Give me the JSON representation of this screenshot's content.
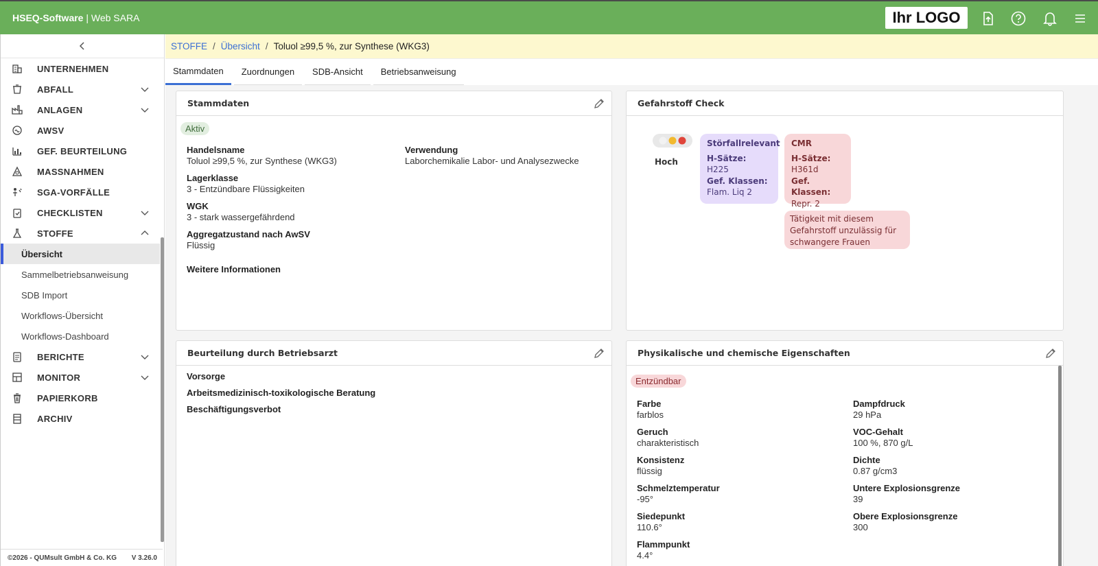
{
  "app": {
    "brand_bold": "HSEQ-Software",
    "brand_rest": " | Web SARA",
    "logo_text": "Ihr LOGO"
  },
  "sidebar": {
    "items": [
      {
        "label": "UNTERNEHMEN",
        "icon": "building-icon",
        "chevron": false
      },
      {
        "label": "ABFALL",
        "icon": "waste-bin-icon",
        "chevron": true
      },
      {
        "label": "ANLAGEN",
        "icon": "factory-icon",
        "chevron": true
      },
      {
        "label": "AWSV",
        "icon": "water-icon",
        "chevron": false
      },
      {
        "label": "GEF. BEURTEILUNG",
        "icon": "chart-icon",
        "chevron": false
      },
      {
        "label": "MASSNAHMEN",
        "icon": "measures-icon",
        "chevron": false
      },
      {
        "label": "SGA-VORFÄLLE",
        "icon": "incident-icon",
        "chevron": false
      },
      {
        "label": "CHECKLISTEN",
        "icon": "checklist-icon",
        "chevron": true
      },
      {
        "label": "STOFFE",
        "icon": "flask-icon",
        "chevron": true
      }
    ],
    "stoffe_sub": [
      "Übersicht",
      "Sammelbetriebsanweisung",
      "SDB Import",
      "Workflows-Übersicht",
      "Workflows-Dashboard"
    ],
    "items_after": [
      {
        "label": "BERICHTE",
        "icon": "report-icon",
        "chevron": true
      },
      {
        "label": "MONITOR",
        "icon": "monitor-icon",
        "chevron": true
      },
      {
        "label": "PAPIERKORB",
        "icon": "trash-icon",
        "chevron": false
      },
      {
        "label": "ARCHIV",
        "icon": "archive-icon",
        "chevron": false
      }
    ],
    "footer_copyright": "©2026 - QUMsult GmbH & Co. KG",
    "footer_version": "V 3.26.0"
  },
  "breadcrumb": {
    "part1": "STOFFE",
    "part2": "Übersicht",
    "current": "Toluol ≥99,5 %, zur Synthese (WKG3)",
    "sep": "/"
  },
  "tabs": [
    "Stammdaten",
    "Zuordnungen",
    "SDB-Ansicht",
    "Betriebsanweisung"
  ],
  "stammdaten": {
    "title": "Stammdaten",
    "status": "Aktiv",
    "handelsname_label": "Handelsname",
    "handelsname": "Toluol ≥99,5 %, zur Synthese (WKG3)",
    "verwendung_label": "Verwendung",
    "verwendung": "Laborchemikalie Labor- und Analysezwecke",
    "lagerklasse_label": "Lagerklasse",
    "lagerklasse": "3 - Entzündbare Flüssigkeiten",
    "wgk_label": "WGK",
    "wgk": "3 - stark wassergefährdend",
    "aggregat_label": "Aggregatzustand nach AwSV",
    "aggregat": "Flüssig",
    "weitere_label": "Weitere Informationen"
  },
  "gefahrstoff": {
    "title": "Gefahrstoff Check",
    "level": "Hoch",
    "stoerfall": {
      "title": "Störfallrelevant",
      "h_label": "H-Sätze:",
      "h": "H225",
      "k_label": "Gef. Klassen:",
      "k": "Flam. Liq 2"
    },
    "cmr": {
      "title": "CMR",
      "h_label": "H-Sätze:",
      "h": "H361d",
      "k_label": "Gef. Klassen:",
      "k": "Repr. 2"
    },
    "warning_line1": "Tätigkeit mit diesem",
    "warning_line2": "Gefahrstoff unzulässig für",
    "warning_line3": "schwangere Frauen"
  },
  "betriebsarzt": {
    "title": "Beurteilung durch Betriebsarzt",
    "vorsorge": "Vorsorge",
    "beratung": "Arbeitsmedizinisch-toxikologische Beratung",
    "verbot": "Beschäftigungsverbot"
  },
  "physik": {
    "title": "Physikalische und chemische Eigenschaften",
    "badge": "Entzündbar",
    "left": [
      {
        "label": "Farbe",
        "value": "farblos"
      },
      {
        "label": "Geruch",
        "value": "charakteristisch"
      },
      {
        "label": "Konsistenz",
        "value": "flüssig"
      },
      {
        "label": "Schmelztemperatur",
        "value": "-95°"
      },
      {
        "label": "Siedepunkt",
        "value": "110.6°"
      },
      {
        "label": "Flammpunkt",
        "value": "4.4°"
      }
    ],
    "right": [
      {
        "label": "Dampfdruck",
        "value": "29 hPa"
      },
      {
        "label": "VOC-Gehalt",
        "value": "100 %, 870 g/L"
      },
      {
        "label": "Dichte",
        "value": "0.87 g/cm3"
      },
      {
        "label": "Untere Explosionsgrenze",
        "value": "39"
      },
      {
        "label": "Obere Explosionsgrenze",
        "value": "300"
      }
    ]
  },
  "colors": {
    "topbar": "#6aaf5a",
    "breadcrumb_bg": "#fdf8cf",
    "accent": "#3b6fd4"
  }
}
